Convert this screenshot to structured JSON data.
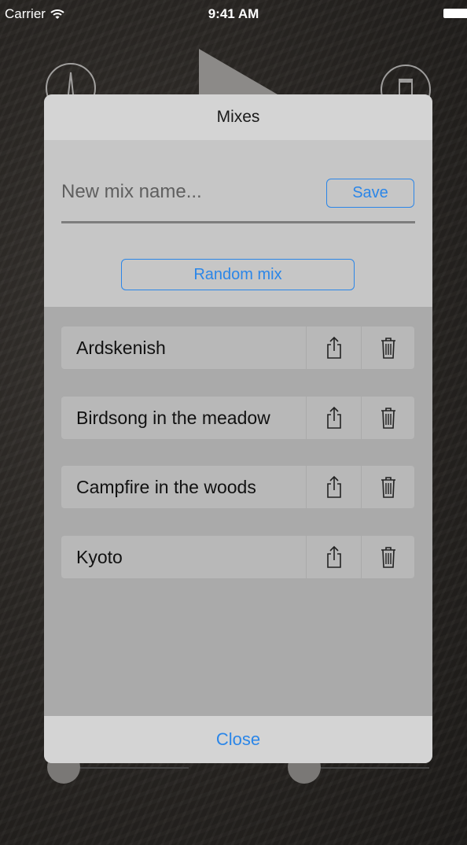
{
  "status_bar": {
    "carrier": "Carrier",
    "time": "9:41 AM"
  },
  "modal": {
    "title": "Mixes",
    "name_input": {
      "placeholder": "New mix name...",
      "value": ""
    },
    "save_label": "Save",
    "random_label": "Random mix",
    "mixes": [
      {
        "name": "Ardskenish"
      },
      {
        "name": "Birdsong in the meadow"
      },
      {
        "name": "Campfire in the woods"
      },
      {
        "name": "Kyoto"
      }
    ],
    "close_label": "Close"
  },
  "icons": {
    "wifi": "wifi-icon",
    "battery": "battery-icon",
    "share": "share-icon",
    "trash": "trash-icon"
  },
  "colors": {
    "accent": "#2b86e8",
    "header_bg": "#d4d4d4",
    "list_bg": "#aaaaaa",
    "row_bg": "#b8b8b8"
  }
}
